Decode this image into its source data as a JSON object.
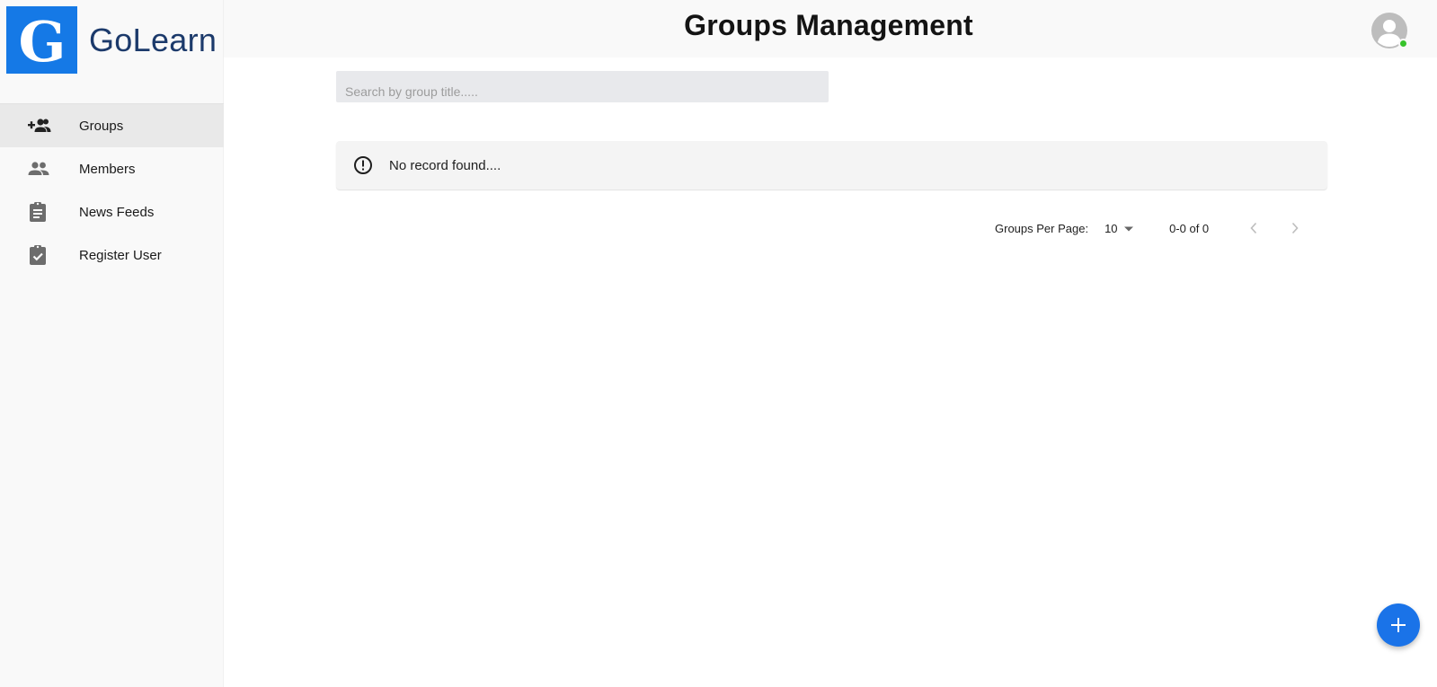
{
  "app": {
    "brand_name": "GoLearn",
    "logo_letter": "G",
    "brand_color": "#1579e6"
  },
  "header": {
    "title": "Groups Management",
    "avatar_icon": "account-circle-icon",
    "status_color": "#37c32b"
  },
  "sidebar": {
    "items": [
      {
        "label": "Groups",
        "icon": "group-add-icon",
        "active": true
      },
      {
        "label": "Members",
        "icon": "people-icon",
        "active": false
      },
      {
        "label": "News Feeds",
        "icon": "assignment-icon",
        "active": false
      },
      {
        "label": "Register User",
        "icon": "assignment-turned-in-icon",
        "active": false
      }
    ]
  },
  "search": {
    "placeholder": "Search by group title.....",
    "value": ""
  },
  "alert": {
    "message": "No record found....",
    "icon": "error-outline-icon"
  },
  "pagination": {
    "per_page_label": "Groups Per Page:",
    "per_page_value": "10",
    "range_text": "0-0 of 0"
  },
  "fab": {
    "icon": "plus-icon",
    "color": "#1a73e8"
  }
}
